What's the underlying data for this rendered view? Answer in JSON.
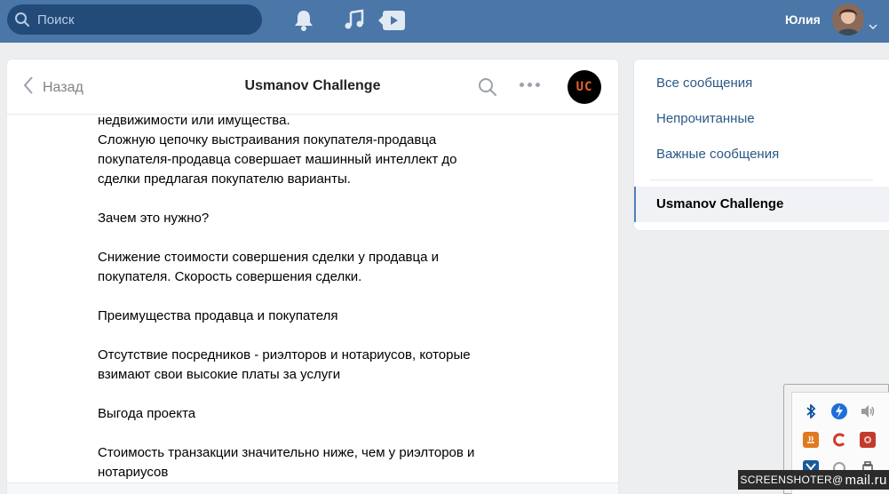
{
  "topbar": {
    "search_placeholder": "Поиск",
    "username": "Юлия"
  },
  "chat": {
    "back_label": "Назад",
    "title": "Usmanov Challenge",
    "avatar_text": "UC"
  },
  "messages": [
    "недвижимости или имущества.\nСложную цепочку выстраивания покупателя-продавца\nпокупателя-продавца совершает машинный интеллект до\nсделки предлагая покупателю варианты.",
    "Зачем это нужно?",
    "Снижение стоимости совершения сделки у продавца и\nпокупателя. Скорость совершения сделки.",
    "Преимущества продавца и покупателя",
    "Отсутствие посредников - риэлторов и нотариусов, которые\nвзимают свои высокие платы за услуги",
    "Выгода проекта",
    "Стоимость транзакции значительно ниже, чем у риэлторов и\nнотариусов"
  ],
  "sidebar": {
    "items": [
      {
        "label": "Все сообщения"
      },
      {
        "label": "Непрочитанные"
      },
      {
        "label": "Важные сообщения"
      }
    ],
    "active_conversation": "Usmanov Challenge"
  },
  "watermark": {
    "prefix": "SCREENSHOTER@",
    "domain": "mail.ru"
  },
  "colors": {
    "header_bg": "#4a76a8",
    "link": "#2a5885",
    "avatar_bg": "#000000",
    "avatar_text": "#e8632b"
  }
}
